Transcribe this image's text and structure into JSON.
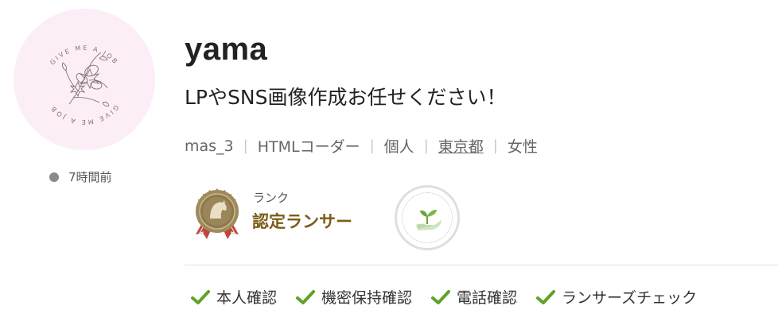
{
  "avatar": {
    "logo_text_top": "GIVE ME A JOB",
    "logo_text_bottom": "GIVE ME A JOB"
  },
  "status": {
    "last_active": "7時間前",
    "dot_color": "#8a8a8a"
  },
  "profile": {
    "username": "yama",
    "tagline": "LPやSNS画像作成お任せください！"
  },
  "meta": {
    "user_id": "mas_3",
    "job": "HTMLコーダー",
    "type": "個人",
    "location": "東京都",
    "gender": "女性",
    "separator": "|"
  },
  "rank": {
    "label": "ランク",
    "value": "認定ランサー",
    "color": "#7a5c16"
  },
  "verifications": [
    {
      "label": "本人確認"
    },
    {
      "label": "機密保持確認"
    },
    {
      "label": "電話確認"
    },
    {
      "label": "ランサーズチェック"
    }
  ],
  "colors": {
    "check": "#5fa229",
    "avatar_bg": "#fbeef7"
  }
}
